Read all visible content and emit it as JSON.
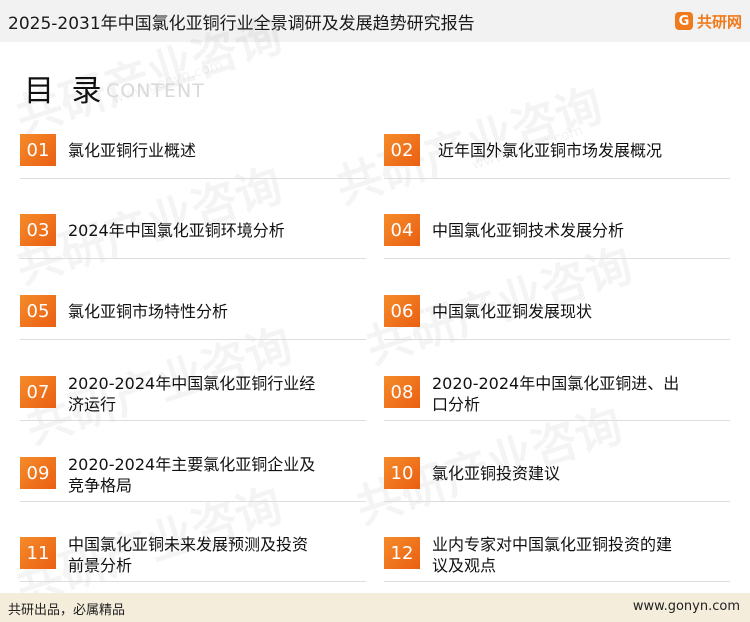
{
  "header": {
    "title": "2025-2031年中国氯化亚铜行业全景调研及发展趋势研究报告",
    "logo_mark": "G",
    "logo_text": "共研网"
  },
  "toc": {
    "heading": "目 录",
    "subheading": "CONTENT"
  },
  "watermark": {
    "text": "共研产业咨询",
    "url": "www.gonyn.com"
  },
  "items": [
    {
      "num": "01",
      "line1": "氯化亚铜行业概述",
      "line2": ""
    },
    {
      "num": "02",
      "line1": "近年国外氯化亚铜市场发展概况",
      "line2": ""
    },
    {
      "num": "03",
      "line1": "2024年中国氯化亚铜环境分析",
      "line2": ""
    },
    {
      "num": "04",
      "line1": "中国氯化亚铜技术发展分析",
      "line2": ""
    },
    {
      "num": "05",
      "line1": "氯化亚铜市场特性分析",
      "line2": ""
    },
    {
      "num": "06",
      "line1": "中国氯化亚铜发展现状",
      "line2": ""
    },
    {
      "num": "07",
      "line1": "2020-2024年中国氯化亚铜行业经",
      "line2": "济运行"
    },
    {
      "num": "08",
      "line1": "2020-2024年中国氯化亚铜进、出",
      "line2": "口分析"
    },
    {
      "num": "09",
      "line1": "2020-2024年主要氯化亚铜企业及",
      "line2": "竞争格局"
    },
    {
      "num": "10",
      "line1": "氯化亚铜投资建议",
      "line2": ""
    },
    {
      "num": "11",
      "line1": "中国氯化亚铜未来发展预测及投资",
      "line2": "前景分析"
    },
    {
      "num": "12",
      "line1": "业内专家对中国氯化亚铜投资的建",
      "line2": "议及观点"
    }
  ],
  "footer": {
    "left": "共研出品，必属精品",
    "right": "www.gonyn.com"
  }
}
